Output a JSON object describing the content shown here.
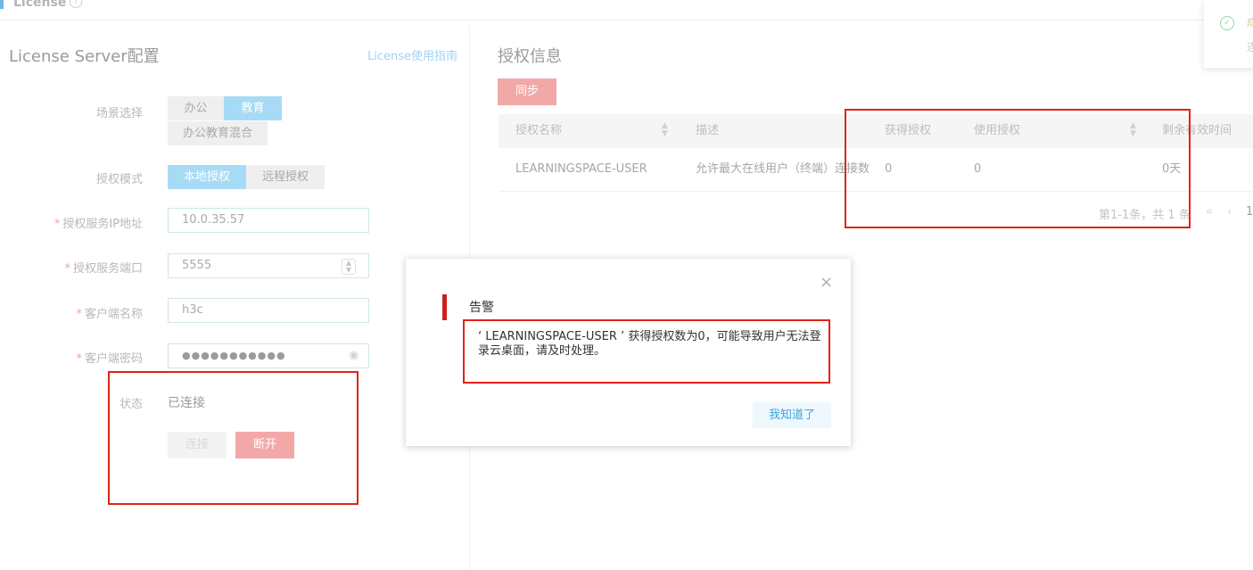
{
  "header": {
    "title": "License",
    "help_glyph": "?"
  },
  "left_panel": {
    "title": "License Server配置",
    "guide_link": "License使用指南",
    "scene": {
      "label": "场景选择",
      "options": [
        "办公",
        "教育",
        "办公教育混合"
      ],
      "selected": "教育"
    },
    "mode": {
      "label": "授权模式",
      "options": [
        "本地授权",
        "远程授权"
      ],
      "selected": "本地授权"
    },
    "server_ip": {
      "label": "授权服务IP地址",
      "value": "10.0.35.57"
    },
    "server_port": {
      "label": "授权服务端口",
      "value": "5555"
    },
    "client_name": {
      "label": "客户端名称",
      "value": "h3c"
    },
    "client_password": {
      "label": "客户端密码",
      "value": "●●●●●●●●●●●"
    },
    "status": {
      "label": "状态",
      "value": "已连接"
    },
    "connect_label": "连接",
    "disconnect_label": "断开"
  },
  "right_panel": {
    "title": "授权信息",
    "sync_label": "同步",
    "table": {
      "columns": [
        "授权名称",
        "描述",
        "获得授权",
        "使用授权",
        "剩余有效时间"
      ],
      "rows": [
        {
          "name": "LEARNINGSPACE-USER",
          "description": "允许最大在线用户（终端）连接数",
          "granted": "0",
          "used": "0",
          "remaining": "0天"
        }
      ]
    },
    "pagination": {
      "summary": "第1-1条，共 1 条",
      "current_page": "1"
    }
  },
  "toast": {
    "icon": "check-circle-icon",
    "line1": "成",
    "line2": "连"
  },
  "modal": {
    "title": "告警",
    "message": "‘ LEARNINGSPACE-USER ’ 获得授权数为0，可能导致用户无法登录云桌面，请及时处理。",
    "ack_label": "我知道了",
    "close_glyph": "×"
  },
  "colors": {
    "accent_blue": "#a7daf5",
    "danger_pink": "#f3a8a8",
    "alert_red": "#cc1f1f",
    "annotation_red": "#e02318"
  }
}
